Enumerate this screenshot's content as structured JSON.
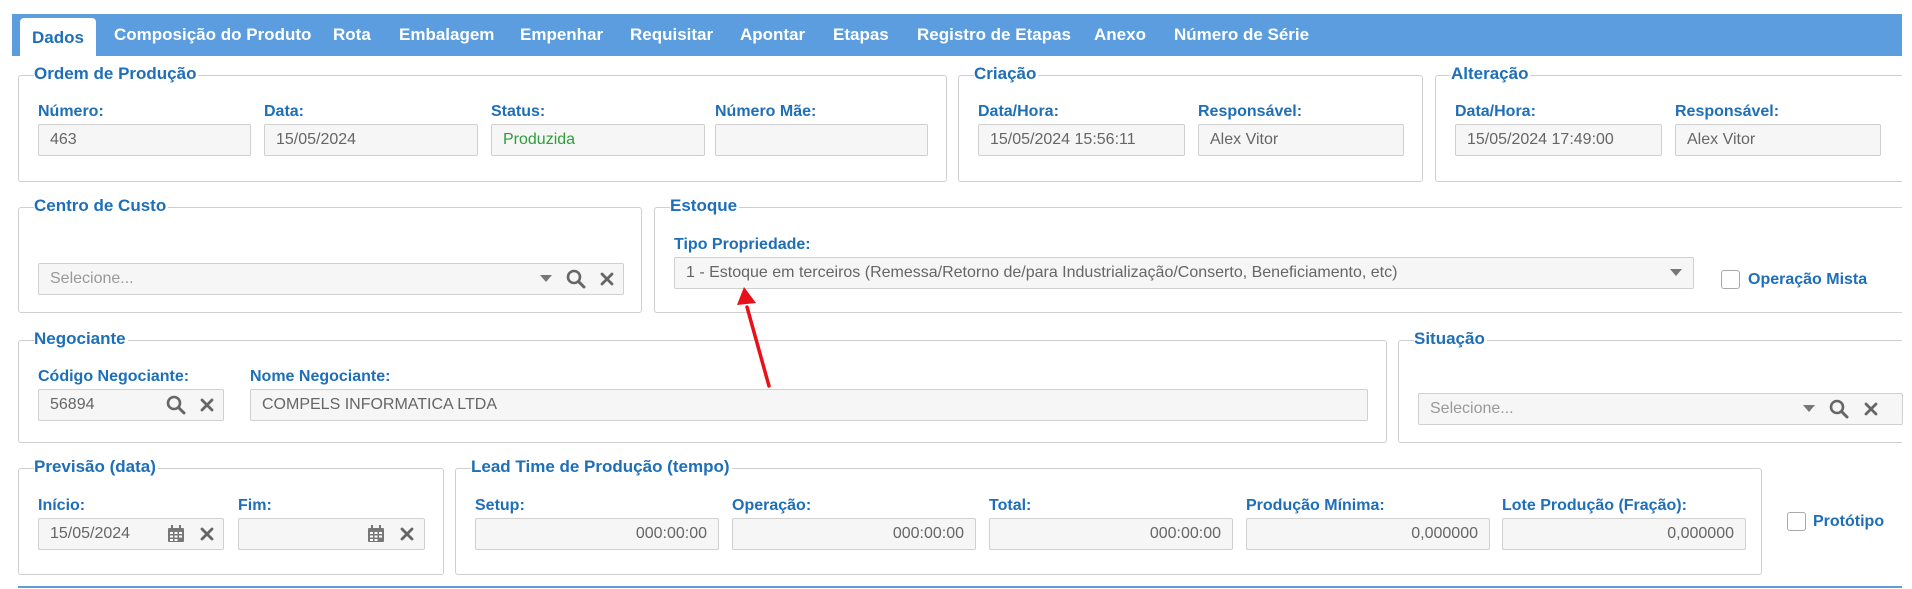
{
  "tabs": [
    {
      "label": "Dados",
      "active": true
    },
    {
      "label": "Composição do Produto"
    },
    {
      "label": "Rota"
    },
    {
      "label": "Embalagem"
    },
    {
      "label": "Empenhar"
    },
    {
      "label": "Requisitar"
    },
    {
      "label": "Apontar"
    },
    {
      "label": "Etapas"
    },
    {
      "label": "Registro de Etapas"
    },
    {
      "label": "Anexo"
    },
    {
      "label": "Número de Série"
    }
  ],
  "ordem": {
    "title": "Ordem de Produção",
    "numero_label": "Número:",
    "numero": "463",
    "data_label": "Data:",
    "data": "15/05/2024",
    "status_label": "Status:",
    "status": "Produzida",
    "numero_mae_label": "Número Mãe:",
    "numero_mae": ""
  },
  "criacao": {
    "title": "Criação",
    "datahora_label": "Data/Hora:",
    "datahora": "15/05/2024 15:56:11",
    "responsavel_label": "Responsável:",
    "responsavel": "Alex Vitor"
  },
  "alteracao": {
    "title": "Alteração",
    "datahora_label": "Data/Hora:",
    "datahora": "15/05/2024 17:49:00",
    "responsavel_label": "Responsável:",
    "responsavel": "Alex Vitor"
  },
  "centro_custo": {
    "title": "Centro de Custo",
    "placeholder": "Selecione..."
  },
  "estoque": {
    "title": "Estoque",
    "tipo_label": "Tipo Propriedade:",
    "tipo_value": "1 - Estoque em terceiros (Remessa/Retorno de/para Industrialização/Conserto, Beneficiamento, etc)",
    "operacao_mista_label": "Operação Mista"
  },
  "negociante": {
    "title": "Negociante",
    "codigo_label": "Código Negociante:",
    "codigo": "56894",
    "nome_label": "Nome Negociante:",
    "nome": "COMPELS INFORMATICA LTDA"
  },
  "situacao": {
    "title": "Situação",
    "placeholder": "Selecione..."
  },
  "previsao": {
    "title": "Previsão (data)",
    "inicio_label": "Início:",
    "inicio": "15/05/2024",
    "fim_label": "Fim:",
    "fim": ""
  },
  "leadtime": {
    "title": "Lead Time de Produção (tempo)",
    "setup_label": "Setup:",
    "setup": "000:00:00",
    "operacao_label": "Operação:",
    "operacao": "000:00:00",
    "total_label": "Total:",
    "total": "000:00:00",
    "producao_minima_label": "Produção Mínima:",
    "producao_minima": "0,000000",
    "lote_label": "Lote Produção (Fração):",
    "lote": "0,000000"
  },
  "prototipo_label": "Protótipo",
  "colors": {
    "accent": "#1e6fb8",
    "tabbar": "#5b9ddf",
    "status": "#2e9d3a",
    "annotation_arrow": "#e8101a"
  },
  "icons": [
    "dropdown-caret-icon",
    "search-icon",
    "close-icon",
    "calendar-icon"
  ]
}
